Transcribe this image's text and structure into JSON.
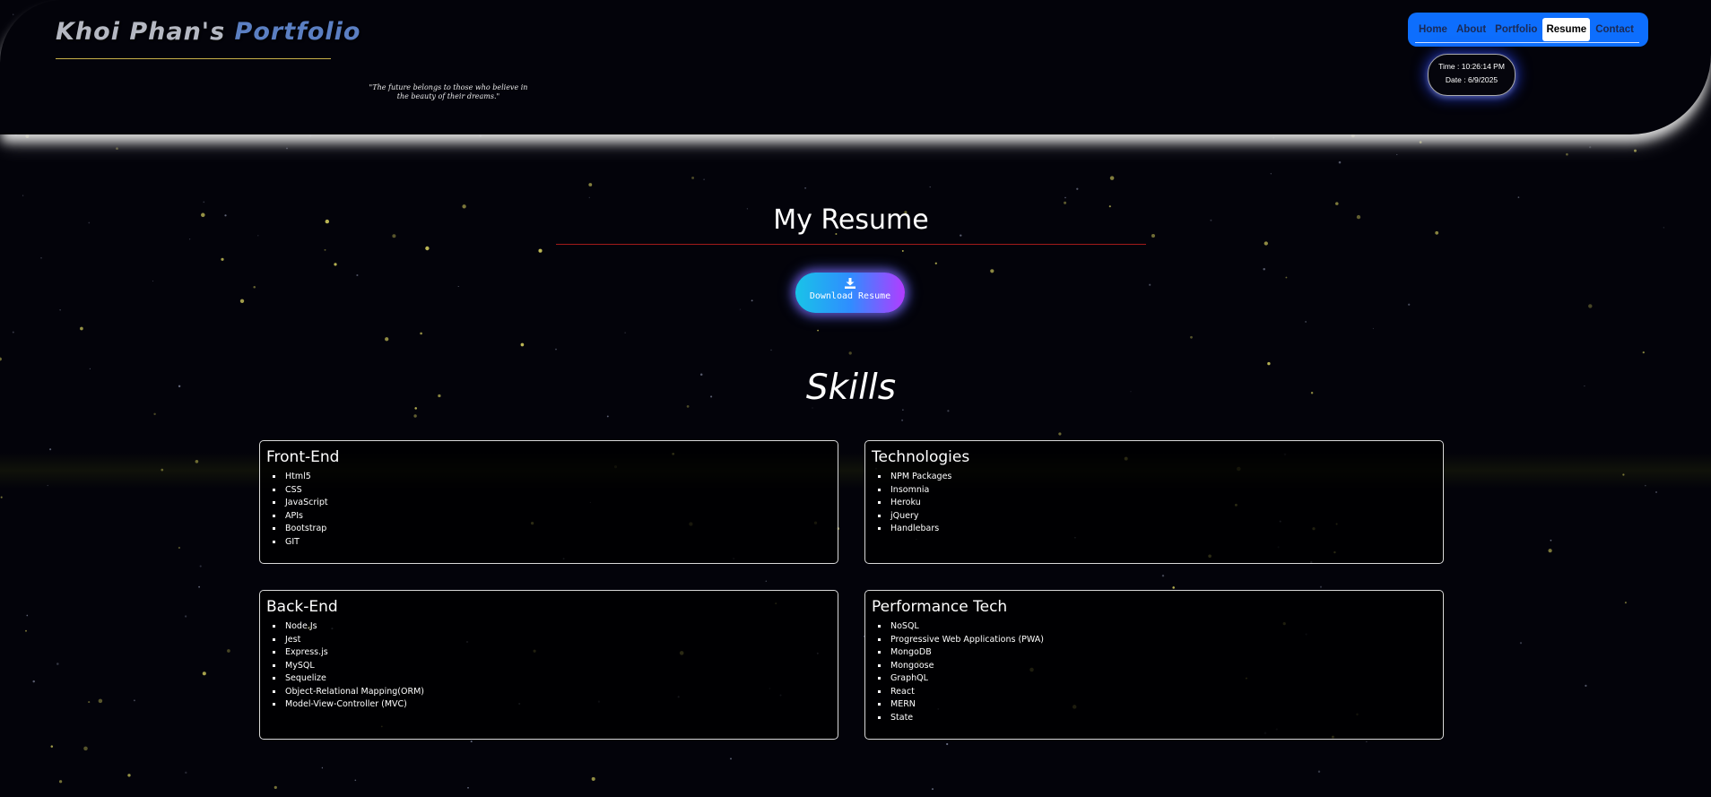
{
  "header": {
    "logo_part1": "Khoi Phan's",
    "logo_part2": "Portfolio",
    "quote": "\"The future belongs to those who believe in the beauty of their dreams.\"",
    "nav": [
      {
        "label": "Home",
        "active": false
      },
      {
        "label": "About",
        "active": false
      },
      {
        "label": "Portfolio",
        "active": false
      },
      {
        "label": "Resume",
        "active": true
      },
      {
        "label": "Contact",
        "active": false
      }
    ],
    "clock": {
      "time": "Time : 10:26:14 PM",
      "date": "Date : 6/9/2025"
    }
  },
  "main": {
    "title": "My Resume",
    "download_button": {
      "label": "Download Resume",
      "icon": "download-icon"
    },
    "skills_title": "Skills",
    "cards": {
      "frontend": {
        "title": "Front-End",
        "items": [
          "Html5",
          "CSS",
          "JavaScript",
          "APIs",
          "Bootstrap",
          "GIT"
        ]
      },
      "technologies": {
        "title": "Technologies",
        "items": [
          "NPM Packages",
          "Insomnia",
          "Heroku",
          "jQuery",
          "Handlebars"
        ]
      },
      "backend": {
        "title": "Back-End",
        "items": [
          "Node.Js",
          "Jest",
          "Express.js",
          "MySQL",
          "Sequelize",
          "Object-Relational Mapping(ORM)",
          "Model-View-Controller (MVC)"
        ]
      },
      "performance": {
        "title": "Performance Tech",
        "items": [
          "NoSQL",
          "Progressive Web Applications (PWA)",
          "MongoDB",
          "Mongoose",
          "GraphQL",
          "React",
          "MERN",
          "State"
        ]
      }
    }
  },
  "colors": {
    "background": "#03030a",
    "nav_bg": "#0d6efd",
    "logo_accent": "#5b7fc2",
    "title_rule": "#a11a1a",
    "button_gradient_start": "#19c3e8",
    "button_gradient_end": "#b23cff"
  }
}
